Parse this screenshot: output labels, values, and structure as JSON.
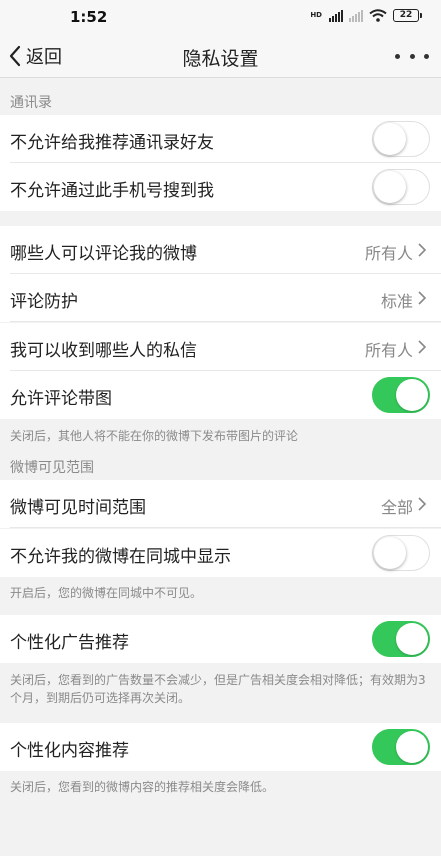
{
  "status_bar": {
    "time": "1:52",
    "hd_label": "HD",
    "battery": "22"
  },
  "nav": {
    "back_label": "返回",
    "title": "隐私设置"
  },
  "sections": {
    "contacts_header": "通讯录",
    "visibility_header": "微博可见范围"
  },
  "rows": {
    "no_recommend_contacts": {
      "label": "不允许给我推荐通讯录好友",
      "toggle_on": false
    },
    "no_search_by_phone": {
      "label": "不允许通过此手机号搜到我",
      "toggle_on": false
    },
    "who_can_comment": {
      "label": "哪些人可以评论我的微博",
      "value": "所有人"
    },
    "comment_protection": {
      "label": "评论防护",
      "value": "标准"
    },
    "who_can_message": {
      "label": "我可以收到哪些人的私信",
      "value": "所有人"
    },
    "allow_comment_images": {
      "label": "允许评论带图",
      "toggle_on": true
    },
    "visible_time_range": {
      "label": "微博可见时间范围",
      "value": "全部"
    },
    "hide_in_local": {
      "label": "不允许我的微博在同城中显示",
      "toggle_on": false
    },
    "personalized_ads": {
      "label": "个性化广告推荐",
      "toggle_on": true
    },
    "personalized_content": {
      "label": "个性化内容推荐",
      "toggle_on": true
    }
  },
  "notes": {
    "comment_images": "关闭后，其他人将不能在你的微博下发布带图片的评论",
    "local": "开启后，您的微博在同城中不可见。",
    "ads": "关闭后，您看到的广告数量不会减少，但是广告相关度会相对降低；有效期为3个月，到期后仍可选择再次关闭。",
    "content": "关闭后，您看到的微博内容的推荐相关度会降低。"
  },
  "colors": {
    "toggle_on": "#34c759",
    "background": "#f2f2f2"
  },
  "icons": [
    "chevron-left-icon",
    "more-icon",
    "chevron-right-icon",
    "signal-icon",
    "wifi-icon",
    "battery-icon"
  ]
}
